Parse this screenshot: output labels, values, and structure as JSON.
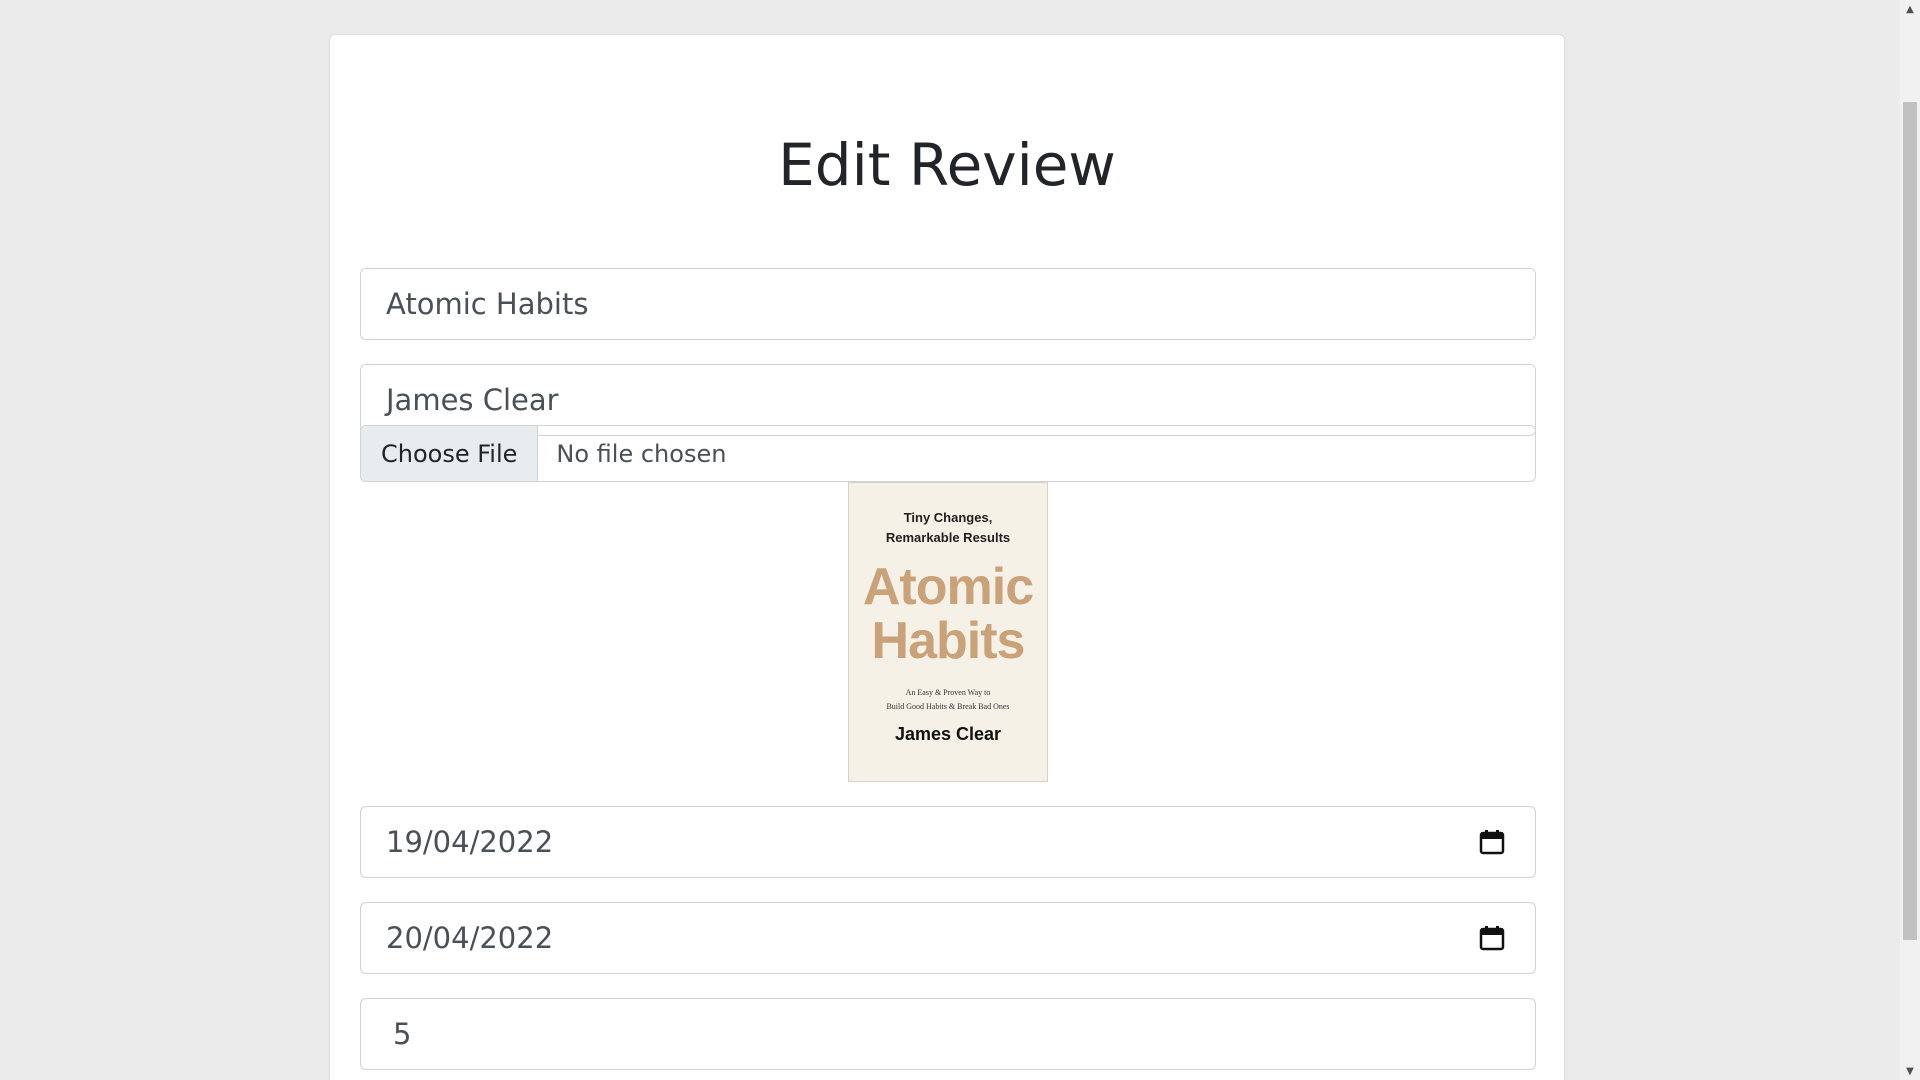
{
  "page": {
    "title": "Edit Review"
  },
  "form": {
    "book_title": "Atomic Habits",
    "author": "James Clear",
    "file_button_label": "Choose File",
    "file_status": "No file chosen",
    "start_date": "19/04/2022",
    "end_date": "20/04/2022",
    "rating": "5"
  },
  "cover": {
    "tagline_line1": "Tiny Changes,",
    "tagline_line2": "Remarkable Results",
    "title_line1": "Atomic",
    "title_line2": "Habits",
    "subtitle_line1": "An Easy & Proven Way to",
    "subtitle_line2": "Build Good Habits & Break Bad Ones",
    "author": "James Clear"
  },
  "icons": {
    "date_picker": "calendar-icon",
    "scroll_up": "triangle-up",
    "scroll_down": "triangle-down"
  },
  "colors": {
    "page_background": "#ebebeb",
    "card_background": "#ffffff",
    "input_border": "#ced4da",
    "file_button_background": "#e9ecef",
    "cover_title": "#c9a27a"
  }
}
